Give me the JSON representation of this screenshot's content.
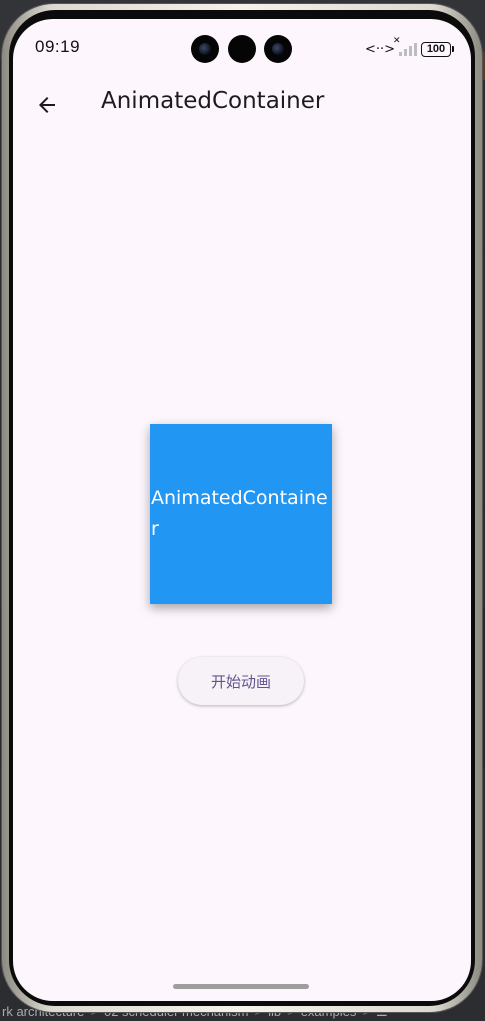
{
  "status_bar": {
    "time": "09:19",
    "network_glyph": "<··>",
    "battery": "100"
  },
  "app_bar": {
    "title": "AnimatedContainer",
    "back_icon": "arrow-left-icon"
  },
  "animated_box": {
    "label": "AnimatedContainer",
    "color": "#2196f3"
  },
  "start_button": {
    "label": "开始动画"
  },
  "ide_breadcrumb": [
    "rk architecture",
    "02 scheduler mechanism",
    "lib",
    "examples"
  ],
  "ide_breadcrumb_separator": ">",
  "ide_breadcrumb_more": "☰",
  "colors": {
    "screen_bg": "#fdf7fd",
    "accent": "#65558f",
    "box": "#2196f3"
  }
}
